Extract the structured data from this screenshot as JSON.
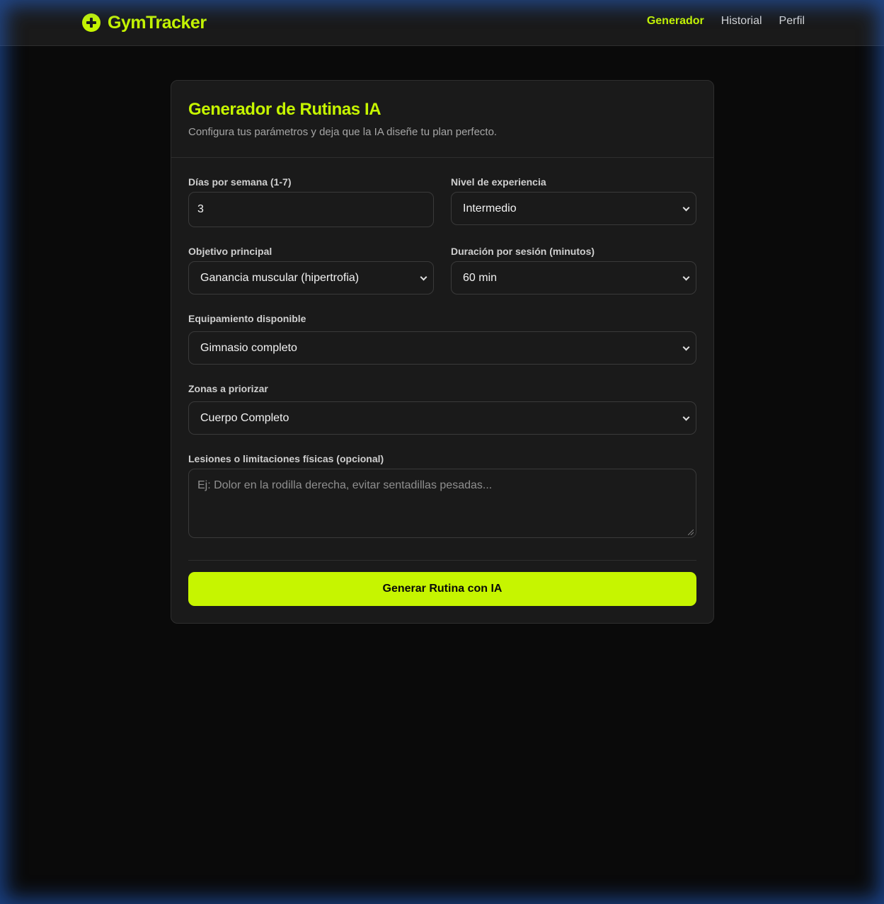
{
  "brand": {
    "name": "GymTracker",
    "icon": "plus-circle-icon",
    "accent_color": "#c6f500"
  },
  "nav": {
    "items": [
      {
        "label": "Generador",
        "active": true
      },
      {
        "label": "Historial",
        "active": false
      },
      {
        "label": "Perfil",
        "active": false
      }
    ]
  },
  "card": {
    "title": "Generador de Rutinas IA",
    "subtitle": "Configura tus parámetros y deja que la IA diseñe tu plan perfecto."
  },
  "form": {
    "days": {
      "label": "Días por semana (1-7)",
      "value": "3"
    },
    "level": {
      "label": "Nivel de experiencia",
      "value": "Intermedio"
    },
    "goal": {
      "label": "Objetivo principal",
      "value": "Ganancia muscular (hipertrofia)"
    },
    "duration": {
      "label": "Duración por sesión (minutos)",
      "value": "60 min"
    },
    "equipment": {
      "label": "Equipamiento disponible",
      "value": "Gimnasio completo"
    },
    "zones": {
      "label": "Zonas a priorizar",
      "value": "Cuerpo Completo"
    },
    "injuries": {
      "label": "Lesiones o limitaciones físicas (opcional)",
      "placeholder": "Ej: Dolor en la rodilla derecha, evitar sentadillas pesadas..."
    },
    "submit_label": "Generar Rutina con IA"
  }
}
